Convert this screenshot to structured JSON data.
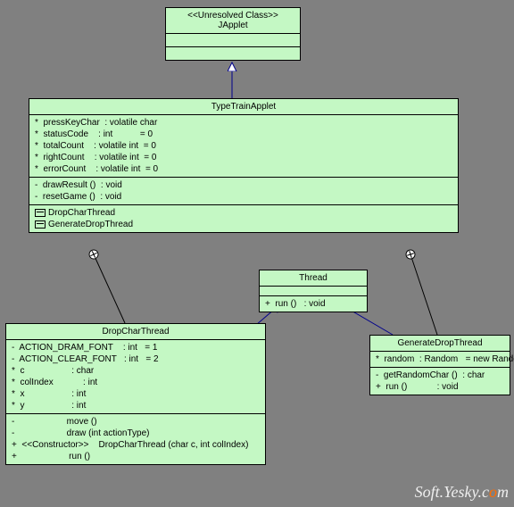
{
  "classes": {
    "japplet": {
      "stereo": "<<Unresolved Class>>",
      "name": "JApplet"
    },
    "typetrain": {
      "name": "TypeTrainApplet",
      "attrs": [
        "*  pressKeyChar  : volatile char",
        "*  statusCode    : int           = 0",
        "*  totalCount    : volatile int  = 0",
        "*  rightCount    : volatile int  = 0",
        "*  errorCount    : volatile int  = 0"
      ],
      "ops": [
        "-  drawResult ()  : void",
        "-  resetGame ()  : void"
      ],
      "nested": [
        "DropCharThread",
        "GenerateDropThread"
      ]
    },
    "thread": {
      "name": "Thread",
      "ops": [
        "+  run ()   : void"
      ]
    },
    "dropchar": {
      "name": "DropCharThread",
      "attrs": [
        "-  ACTION_DRAM_FONT    : int   = 1",
        "-  ACTION_CLEAR_FONT   : int   = 2",
        "*  c                   : char",
        "*  colIndex            : int",
        "*  x                   : int",
        "*  y                   : int"
      ],
      "ops": [
        "-                     move ()",
        "-                     draw (int actionType)",
        "+  <<Constructor>>    DropCharThread (char c, int colIndex)",
        "+                     run ()"
      ]
    },
    "gendrop": {
      "name": "GenerateDropThread",
      "attrs": [
        "*  random  : Random   = new Random()"
      ],
      "ops": [
        "-  getRandomChar ()  : char",
        "+  run ()            : void"
      ]
    }
  },
  "watermark": {
    "t1": "Soft.Yesky.c",
    "t2": "o",
    "t3": "m"
  }
}
